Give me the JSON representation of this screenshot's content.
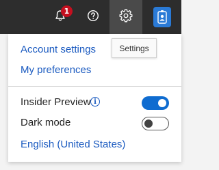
{
  "header": {
    "notifications_count": "1",
    "icons": [
      "bell-icon",
      "help-icon",
      "gear-icon",
      "avatar"
    ]
  },
  "tooltip": {
    "text": "Settings"
  },
  "menu": {
    "account_settings": "Account settings",
    "my_preferences": "My preferences",
    "insider_preview_label": "Insider Preview",
    "insider_preview_on": true,
    "dark_mode_label": "Dark mode",
    "dark_mode_on": false,
    "language": "English (United States)"
  },
  "colors": {
    "topbar": "#2d2d2d",
    "link": "#1a5ac0",
    "toggle_on": "#0f6cd0",
    "badge": "#c50f1f"
  }
}
